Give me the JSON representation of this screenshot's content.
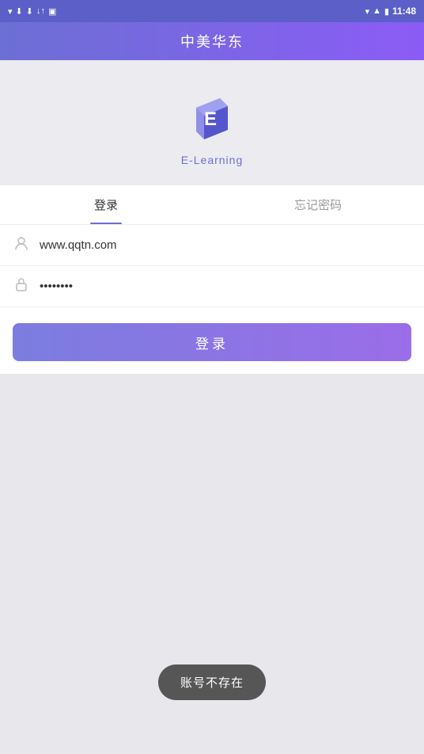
{
  "statusBar": {
    "time": "11:48"
  },
  "topBar": {
    "title": "中美华东"
  },
  "logo": {
    "text": "E-Learning"
  },
  "tabs": [
    {
      "label": "登录",
      "active": true
    },
    {
      "label": "忘记密码",
      "active": false
    }
  ],
  "form": {
    "usernamePlaceholder": "",
    "usernameValue": "www.qqtn.com",
    "passwordPlaceholder": "",
    "passwordValue": "••••••••"
  },
  "loginButton": {
    "label": "登录"
  },
  "toast": {
    "message": "账号不存在"
  }
}
